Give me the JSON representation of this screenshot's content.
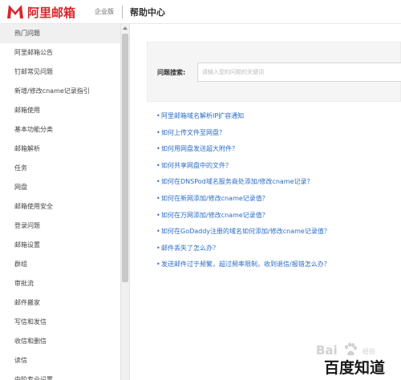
{
  "header": {
    "brand": "阿里邮箱",
    "edition": "企业版",
    "section_title": "帮助中心",
    "brand_color": "#d8262c"
  },
  "sidebar": {
    "items": [
      {
        "label": "热门问题",
        "active": true
      },
      {
        "label": "阿里邮箱公告"
      },
      {
        "label": "钉邮常见问题"
      },
      {
        "label": "新增/修改cname记录指引"
      },
      {
        "label": "邮箱使用"
      },
      {
        "label": "基本功能分类"
      },
      {
        "label": "邮箱解析"
      },
      {
        "label": "任务"
      },
      {
        "label": "网盘"
      },
      {
        "label": "邮箱使用安全"
      },
      {
        "label": "登录问题"
      },
      {
        "label": "邮箱设置"
      },
      {
        "label": "群组"
      },
      {
        "label": "审批流"
      },
      {
        "label": "邮件搬家"
      },
      {
        "label": "写信和发信"
      },
      {
        "label": "收信和删信"
      },
      {
        "label": "读信"
      },
      {
        "label": "中阶专业设置"
      }
    ]
  },
  "search": {
    "label": "问题搜索:",
    "placeholder": "请输入您的问题的关键词"
  },
  "faq": {
    "bullet": "•",
    "items": [
      "阿里邮箱域名解析IP扩容通知",
      "如何上传文件至网盘？",
      "如何用网盘发送超大附件？",
      "如何共享网盘中的文件？",
      "如何在DNSPod域名服务商处添加/修改cname记录？",
      "如何在新网添加/修改cname记录值？",
      "如何在万网添加/修改cname记录值？",
      "如何在GoDaddy注册的域名如何添加/修改cname记录值？",
      "邮件丢失了怎么办？",
      "发送邮件过于频繁，超过频率限制，收到退信/报错怎么办？"
    ]
  },
  "watermark": {
    "en": "Bai",
    "jingyan": "经验",
    "cn": "百度知道"
  }
}
